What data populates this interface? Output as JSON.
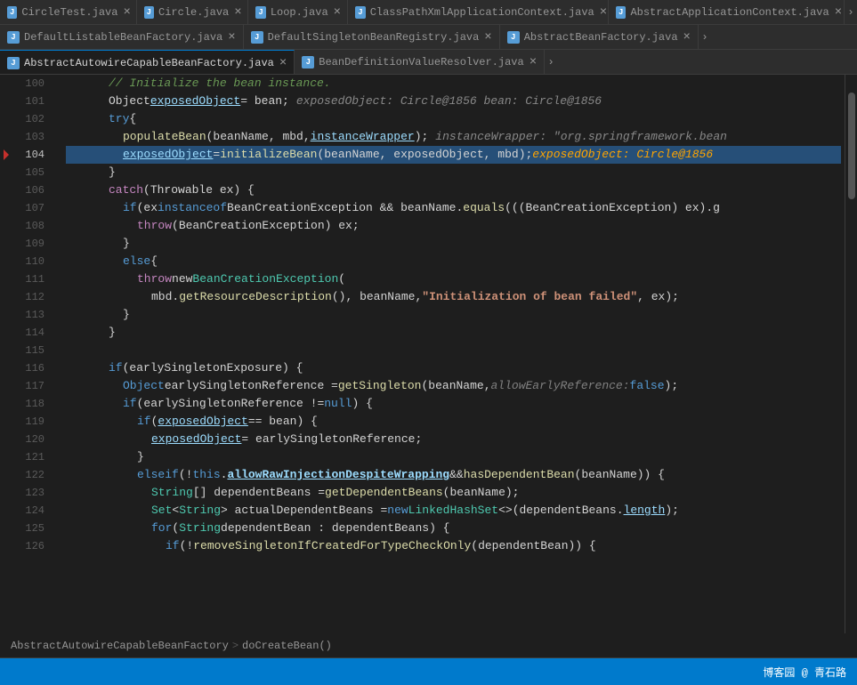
{
  "tabs_row1": [
    {
      "label": "CircleTest.java",
      "icon": "J",
      "active": false,
      "closable": true
    },
    {
      "label": "Circle.java",
      "icon": "J",
      "active": false,
      "closable": true
    },
    {
      "label": "Loop.java",
      "icon": "J",
      "active": false,
      "closable": true
    },
    {
      "label": "ClassPathXmlApplicationContext.java",
      "icon": "J",
      "active": false,
      "closable": true
    },
    {
      "label": "AbstractApplicationContext.java",
      "icon": "J",
      "active": false,
      "closable": true
    }
  ],
  "tabs_row2": [
    {
      "label": "DefaultListableBeanFactory.java",
      "icon": "J",
      "active": false,
      "closable": true
    },
    {
      "label": "DefaultSingletonBeanRegistry.java",
      "icon": "J",
      "active": false,
      "closable": true
    },
    {
      "label": "AbstractBeanFactory.java",
      "icon": "J",
      "active": false,
      "closable": true
    }
  ],
  "tabs_row3": [
    {
      "label": "AbstractAutowireCapableBeanFactory.java",
      "icon": "J",
      "active": true,
      "closable": true
    },
    {
      "label": "BeanDefinitionValueResolver.java",
      "icon": "J",
      "active": false,
      "closable": true
    }
  ],
  "breadcrumb": {
    "path": "AbstractAutowireCapableBeanFactory",
    "separator": ">",
    "method": "doCreateBean()"
  },
  "status_bar": {
    "text": "博客园 @ 青石路"
  },
  "code_lines": [
    {
      "num": "",
      "indent": 3,
      "tokens": [
        {
          "t": "// Initialize the bean instance.",
          "c": "comment"
        }
      ]
    },
    {
      "num": "",
      "indent": 3,
      "tokens": [
        {
          "t": "Object ",
          "c": "plain"
        },
        {
          "t": "exposedObject",
          "c": "var-local underline"
        },
        {
          "t": " = bean;",
          "c": "plain"
        },
        {
          "t": "  exposedObject: Circle@1856   bean: Circle@1856",
          "c": "inline-hint"
        }
      ]
    },
    {
      "num": "",
      "indent": 3,
      "tokens": [
        {
          "t": "try",
          "c": "kw"
        },
        {
          "t": " {",
          "c": "plain"
        }
      ]
    },
    {
      "num": "",
      "indent": 4,
      "tokens": [
        {
          "t": "populateBean",
          "c": "method"
        },
        {
          "t": "(beanName, mbd, ",
          "c": "plain"
        },
        {
          "t": "instanceWrapper",
          "c": "var-local underline"
        },
        {
          "t": ");",
          "c": "plain"
        },
        {
          "t": "  instanceWrapper: \"org.springframework.bean",
          "c": "inline-hint"
        }
      ]
    },
    {
      "num": "",
      "indent": 4,
      "tokens": [
        {
          "t": "exposedObject",
          "c": "var-local underline"
        },
        {
          "t": " = ",
          "c": "plain"
        },
        {
          "t": "initializeBean",
          "c": "method"
        },
        {
          "t": "(beanName, exposedObject, mbd);",
          "c": "plain"
        },
        {
          "t": "  exposedObject: Circle@1856",
          "c": "inline-val"
        }
      ],
      "highlight": true
    },
    {
      "num": "",
      "indent": 3,
      "tokens": [
        {
          "t": "}",
          "c": "plain"
        }
      ]
    },
    {
      "num": "",
      "indent": 3,
      "tokens": [
        {
          "t": "catch",
          "c": "kw-ctrl"
        },
        {
          "t": " (Throwable ex) {",
          "c": "plain"
        }
      ]
    },
    {
      "num": "",
      "indent": 4,
      "tokens": [
        {
          "t": "if",
          "c": "kw"
        },
        {
          "t": " (ex ",
          "c": "plain"
        },
        {
          "t": "instanceof",
          "c": "kw"
        },
        {
          "t": " BeanCreationException && beanName.",
          "c": "plain"
        },
        {
          "t": "equals",
          "c": "method"
        },
        {
          "t": "(((BeanCreationException) ex).g",
          "c": "plain"
        }
      ]
    },
    {
      "num": "",
      "indent": 5,
      "tokens": [
        {
          "t": "throw",
          "c": "kw-ctrl"
        },
        {
          "t": " (BeanCreationException) ex;",
          "c": "plain"
        }
      ]
    },
    {
      "num": "",
      "indent": 4,
      "tokens": [
        {
          "t": "}",
          "c": "plain"
        }
      ]
    },
    {
      "num": "",
      "indent": 4,
      "tokens": [
        {
          "t": "else",
          "c": "kw"
        },
        {
          "t": " {",
          "c": "plain"
        }
      ]
    },
    {
      "num": "",
      "indent": 5,
      "tokens": [
        {
          "t": "throw",
          "c": "kw-ctrl"
        },
        {
          "t": " new ",
          "c": "plain"
        },
        {
          "t": "BeanCreationException",
          "c": "type"
        },
        {
          "t": "(",
          "c": "plain"
        }
      ]
    },
    {
      "num": "",
      "indent": 6,
      "tokens": [
        {
          "t": "mbd.",
          "c": "plain"
        },
        {
          "t": "getResourceDescription",
          "c": "method"
        },
        {
          "t": "(), beanName, ",
          "c": "plain"
        },
        {
          "t": "\"Initialization of bean failed\"",
          "c": "str bold"
        },
        {
          "t": ", ex);",
          "c": "plain"
        }
      ]
    },
    {
      "num": "",
      "indent": 4,
      "tokens": [
        {
          "t": "}",
          "c": "plain"
        }
      ]
    },
    {
      "num": "",
      "indent": 3,
      "tokens": [
        {
          "t": "}",
          "c": "plain"
        }
      ]
    },
    {
      "num": "",
      "indent": 0,
      "tokens": []
    },
    {
      "num": "",
      "indent": 3,
      "tokens": [
        {
          "t": "if",
          "c": "kw"
        },
        {
          "t": " (earlySingletonExposure) {",
          "c": "plain"
        }
      ]
    },
    {
      "num": "",
      "indent": 4,
      "tokens": [
        {
          "t": "Object",
          "c": "kw"
        },
        {
          "t": " earlySingletonReference = ",
          "c": "plain"
        },
        {
          "t": "getSingleton",
          "c": "method"
        },
        {
          "t": "(beanName,  ",
          "c": "plain"
        },
        {
          "t": "allowEarlyReference:",
          "c": "param-hint"
        },
        {
          "t": " ",
          "c": "plain"
        },
        {
          "t": "false",
          "c": "kw"
        },
        {
          "t": ");",
          "c": "plain"
        }
      ]
    },
    {
      "num": "",
      "indent": 4,
      "tokens": [
        {
          "t": "if",
          "c": "kw"
        },
        {
          "t": " (earlySingletonReference != ",
          "c": "plain"
        },
        {
          "t": "null",
          "c": "kw"
        },
        {
          "t": ") {",
          "c": "plain"
        }
      ]
    },
    {
      "num": "",
      "indent": 5,
      "tokens": [
        {
          "t": "if",
          "c": "kw"
        },
        {
          "t": " (",
          "c": "plain"
        },
        {
          "t": "exposedObject",
          "c": "var-local underline"
        },
        {
          "t": " == bean) {",
          "c": "plain"
        }
      ]
    },
    {
      "num": "",
      "indent": 6,
      "tokens": [
        {
          "t": "exposedObject",
          "c": "var-local underline"
        },
        {
          "t": " = earlySingletonReference;",
          "c": "plain"
        }
      ]
    },
    {
      "num": "",
      "indent": 5,
      "tokens": [
        {
          "t": "}",
          "c": "plain"
        }
      ]
    },
    {
      "num": "",
      "indent": 5,
      "tokens": [
        {
          "t": "else",
          "c": "kw"
        },
        {
          "t": " ",
          "c": "plain"
        },
        {
          "t": "if",
          "c": "kw"
        },
        {
          "t": " (!",
          "c": "plain"
        },
        {
          "t": "this",
          "c": "kw"
        },
        {
          "t": ".",
          "c": "plain"
        },
        {
          "t": "allowRawInjectionDespiteWrapping",
          "c": "var-field underline bold"
        },
        {
          "t": " && ",
          "c": "plain"
        },
        {
          "t": "hasDependentBean",
          "c": "method"
        },
        {
          "t": "(beanName)) {",
          "c": "plain"
        }
      ]
    },
    {
      "num": "",
      "indent": 6,
      "tokens": [
        {
          "t": "String",
          "c": "type"
        },
        {
          "t": "[] dependentBeans = ",
          "c": "plain"
        },
        {
          "t": "getDependentBeans",
          "c": "method"
        },
        {
          "t": "(beanName);",
          "c": "plain"
        }
      ]
    },
    {
      "num": "",
      "indent": 6,
      "tokens": [
        {
          "t": "Set",
          "c": "type"
        },
        {
          "t": "<",
          "c": "plain"
        },
        {
          "t": "String",
          "c": "type"
        },
        {
          "t": "> actualDependentBeans = ",
          "c": "plain"
        },
        {
          "t": "new",
          "c": "kw"
        },
        {
          "t": " ",
          "c": "plain"
        },
        {
          "t": "LinkedHashSet",
          "c": "type"
        },
        {
          "t": "<>(dependentBeans.",
          "c": "plain"
        },
        {
          "t": "length",
          "c": "var-field underline"
        },
        {
          "t": ");",
          "c": "plain"
        }
      ]
    },
    {
      "num": "",
      "indent": 6,
      "tokens": [
        {
          "t": "for",
          "c": "kw"
        },
        {
          "t": " (",
          "c": "plain"
        },
        {
          "t": "String",
          "c": "type"
        },
        {
          "t": " dependentBean : dependentBeans) {",
          "c": "plain"
        }
      ]
    },
    {
      "num": "",
      "indent": 7,
      "tokens": [
        {
          "t": "if",
          "c": "kw"
        },
        {
          "t": " (!",
          "c": "plain"
        },
        {
          "t": "removeSingletonIfCreatedForTypeCheckOnly",
          "c": "method"
        },
        {
          "t": "(dependentBean)) {",
          "c": "plain"
        }
      ]
    }
  ]
}
